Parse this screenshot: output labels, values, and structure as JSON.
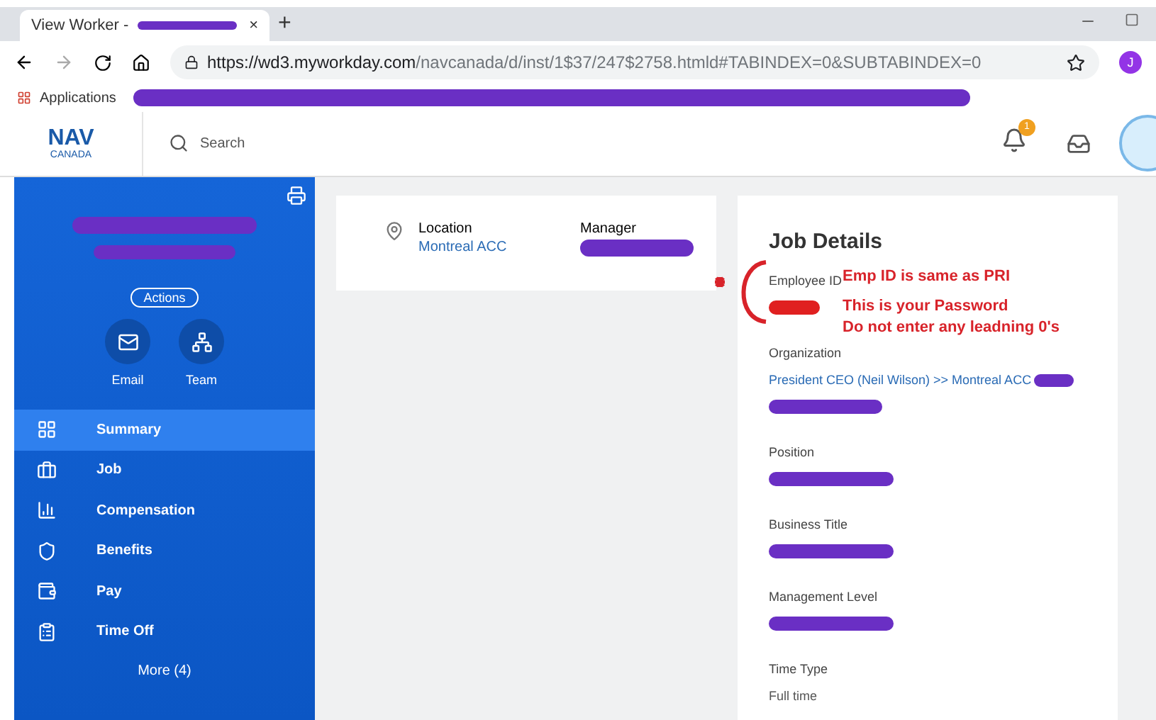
{
  "browser": {
    "tab": {
      "title": "View Worker -",
      "close": "×"
    },
    "new_tab": "+",
    "url_host": "https://wd3.myworkday.com",
    "url_path": "/navcanada/d/inst/1$37/247$2758.htmld#TABINDEX=0&SUBTABINDEX=0",
    "profile": "J",
    "bookmarks": [
      {
        "label": "Applications"
      }
    ]
  },
  "header": {
    "logo_top": "NAV",
    "logo_bottom": "CANADA",
    "search_placeholder": "Search",
    "notification_count": "1"
  },
  "sidebar": {
    "actions": "Actions",
    "quick_links": [
      {
        "label": "Email"
      },
      {
        "label": "Team"
      }
    ],
    "items": [
      {
        "label": "Summary",
        "selected": true
      },
      {
        "label": "Job",
        "selected": false
      },
      {
        "label": "Compensation",
        "selected": false
      },
      {
        "label": "Benefits",
        "selected": false
      },
      {
        "label": "Pay",
        "selected": false
      },
      {
        "label": "Time Off",
        "selected": false
      }
    ],
    "more": "More (4)"
  },
  "summary_card": {
    "location_label": "Location",
    "location_value": "Montreal ACC",
    "manager_label": "Manager"
  },
  "job_details": {
    "title": "Job Details",
    "fields": [
      {
        "label": "Employee ID"
      },
      {
        "label": "Organization",
        "value": "President CEO (Neil Wilson) >> Montreal ACC"
      },
      {
        "label": "Position"
      },
      {
        "label": "Business Title"
      },
      {
        "label": "Management Level"
      },
      {
        "label": "Time Type",
        "value": "Full time"
      }
    ]
  },
  "annotations": [
    "Emp ID is same as PRI",
    "This is your Password",
    "Do not enter any leadning 0's"
  ]
}
